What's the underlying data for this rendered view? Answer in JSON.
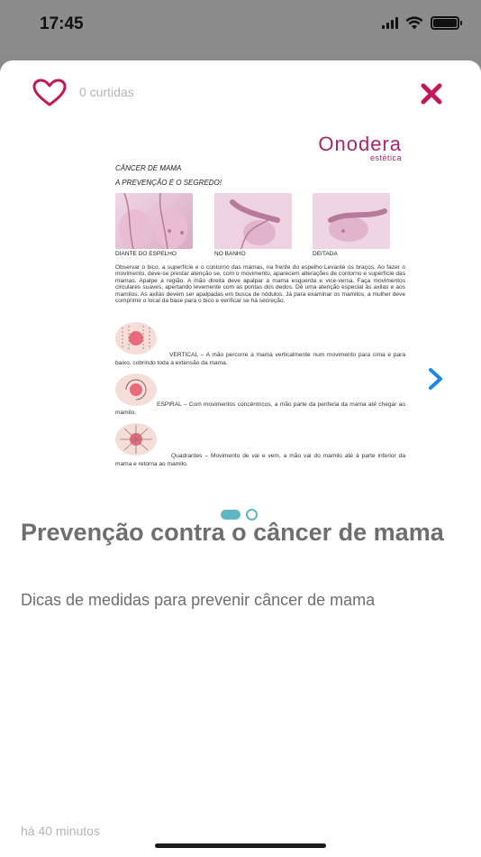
{
  "status_bar": {
    "time": "17:45",
    "battery_level": 1.0
  },
  "header": {
    "likes_label": "0 curtidas",
    "heart_color": "#c2185b",
    "close_color": "#c2185b"
  },
  "gallery": {
    "current_page": 1,
    "page_count": 2,
    "slide": {
      "brand": "Onodera",
      "brand_sub": "estética",
      "title": "CÂNCER DE MAMA",
      "subtitle": "A PREVENÇÃO É O SEGREDO!",
      "photo_captions": [
        "DIANTE DO ESPELHO",
        "NO BANHO",
        "DEITADA"
      ],
      "body": "Observar o bico, a superfície e o contorno das mamas, na frente do espelho Levante os braços. Ao fazer o movimento, deve-se prestar atenção se, com o movimento, aparecem alterações de contorno e superfície das mamas. Apalpe a região. A mão direita deve apalpar a mama esquerda e vice-versa. Faça movimentos circulares suaves, apertando levemente com as pontas dos dedos. Dê uma atenção especial às axilas e aos mamilos. As axilas devem ser apalpadas em busca de nódulos. Já para examinar os mamilos, a mulher deve comprimir o local da base para o bico e verificar se há secreção.",
      "techniques": [
        {
          "text": "VERTICAL – A mão percorre a mama verticalmente num movimento para cima e para baixo, cobrindo toda a extensão da mama."
        },
        {
          "text": "ESPIRAL – Com movimentos concêntricos, a mão parte da periferia da mama até chegar ao mamilo."
        },
        {
          "text": "Quadrantes – Movimento de vai e vem, a mão vai do mamilo até à parte inferior da mama e retorna ao mamilo."
        }
      ]
    },
    "accent_color": "#62b6c4"
  },
  "article": {
    "title": "Prevenção contra o câncer de mama",
    "subtitle": "Dicas de medidas para prevenir câncer de mama",
    "timestamp": "há 40 minutos"
  }
}
